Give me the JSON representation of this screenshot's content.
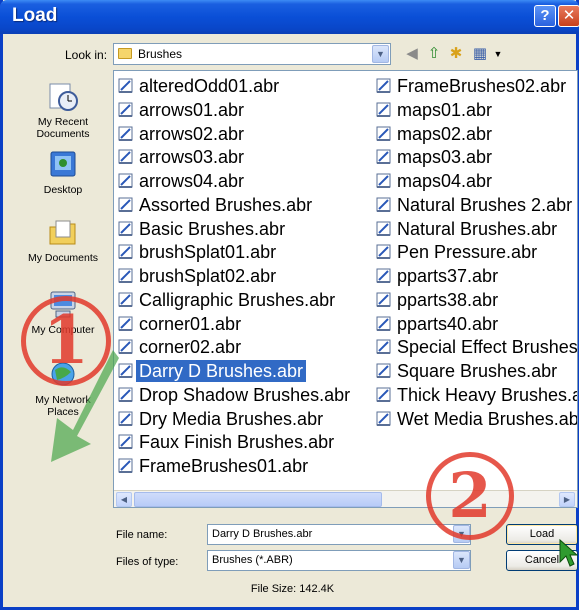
{
  "window": {
    "title": "Load",
    "help_glyph": "?",
    "close_glyph": "✕"
  },
  "toolbar": {
    "look_in_label": "Look in:",
    "look_in_value": "Brushes"
  },
  "places": [
    {
      "label": "My Recent Documents"
    },
    {
      "label": "Desktop"
    },
    {
      "label": "My Documents"
    },
    {
      "label": "My Computer"
    },
    {
      "label": "My Network Places"
    }
  ],
  "files_col1": [
    "alteredOdd01.abr",
    "arrows01.abr",
    "arrows02.abr",
    "arrows03.abr",
    "arrows04.abr",
    "Assorted Brushes.abr",
    "Basic Brushes.abr",
    "brushSplat01.abr",
    "brushSplat02.abr",
    "Calligraphic Brushes.abr",
    "corner01.abr",
    "corner02.abr",
    "Darry D Brushes.abr",
    "Drop Shadow Brushes.abr",
    "Dry Media Brushes.abr",
    "Faux Finish Brushes.abr",
    "FrameBrushes01.abr"
  ],
  "files_col2": [
    "FrameBrushes02.abr",
    "maps01.abr",
    "maps02.abr",
    "maps03.abr",
    "maps04.abr",
    "Natural Brushes 2.abr",
    "Natural Brushes.abr",
    "Pen Pressure.abr",
    "pparts37.abr",
    "pparts38.abr",
    "pparts40.abr",
    "Special Effect Brushes.abr",
    "Square Brushes.abr",
    "Thick Heavy Brushes.abr",
    "Wet Media Brushes.abr"
  ],
  "selected_file": "Darry D Brushes.abr",
  "form": {
    "file_name_label": "File name:",
    "file_name_value": "Darry D Brushes.abr",
    "file_type_label": "Files of type:",
    "file_type_value": "Brushes (*.ABR)",
    "load_label": "Load",
    "cancel_label": "Cancel"
  },
  "status": {
    "file_size": "File Size: 142.4K"
  },
  "annotations": {
    "step1": "1",
    "step2": "2"
  },
  "colors": {
    "title_bar": "#0a4fd7",
    "selection": "#316ac5",
    "annotation": "#e23a2c"
  }
}
